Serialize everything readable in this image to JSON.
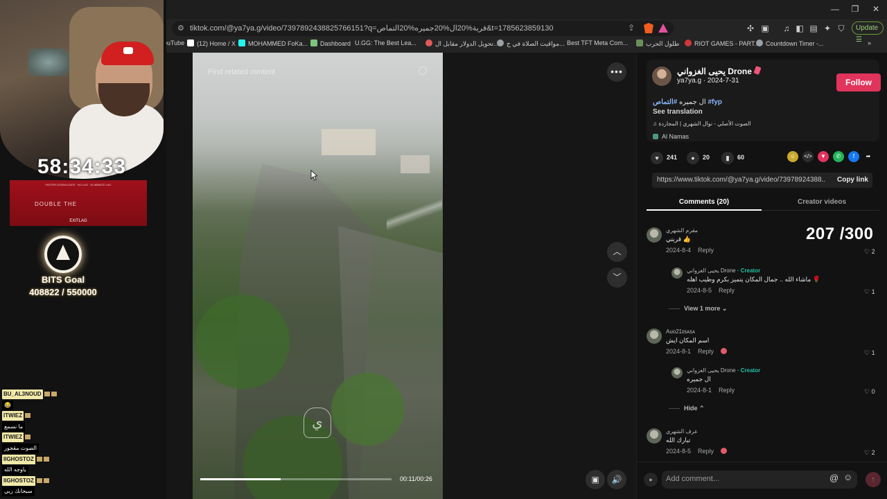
{
  "browser": {
    "url": "tiktok.com/@ya7ya.g/video/7397892438825766151?q=قرية%20ال%20جميره%20التماص&t=1785623859130",
    "update_label": "Update",
    "bookmarks": [
      {
        "label": "ouTube",
        "color": "#e0342f"
      },
      {
        "label": "(12) Home / X",
        "color": "#ffffff"
      },
      {
        "label": "MOHAMMED FoKa...",
        "color": "#25f4ee"
      },
      {
        "label": "Dashboard",
        "color": "#7bc67e"
      },
      {
        "label": "U.GG: The Best Lea...",
        "color": "#3b82f6"
      },
      {
        "label": "تحويل الدولار مقابل ال...",
        "color": "#e05a5a"
      },
      {
        "label": "مواقيت الصلاة في ج...",
        "color": "#9aa0a6"
      },
      {
        "label": "Best TFT Meta Com...",
        "color": "#c9a24a"
      },
      {
        "label": "طلول الحرب",
        "color": "#6b8e5a"
      },
      {
        "label": "RIOT GAMES - PART...",
        "color": "#d13639"
      },
      {
        "label": "Countdown Timer -...",
        "color": "#9aa0a6"
      }
    ]
  },
  "overlay": {
    "timer": "58:34:33",
    "banner_top": "FASTER DOWNLOADS · NO LAG · ELIMINATE LAG",
    "banner_mid": "DOUBLE      THE",
    "banner_bottom": "EXITLAG",
    "goal_title": "BITS Goal",
    "goal_value": "408822 / 550000",
    "chat": [
      {
        "user": "BU_AL3NOUD",
        "msg": ""
      },
      {
        "user": "",
        "msg": "😂"
      },
      {
        "user": "ITWIEZ",
        "msg": ""
      },
      {
        "user": "",
        "msg": "ما نسمع"
      },
      {
        "user": "ITWIEZ",
        "msg": ""
      },
      {
        "user": "",
        "msg": "الصوت مقجور"
      },
      {
        "user": "IIGHOSTOZ",
        "msg": ""
      },
      {
        "user": "",
        "msg": "ياوجه الله"
      },
      {
        "user": "IIGHOSTOZ",
        "msg": ""
      },
      {
        "user": "",
        "msg": "سبحانك ربي"
      }
    ]
  },
  "video": {
    "search_placeholder": "Find related content",
    "watermark": "ي",
    "progress": 0.42,
    "time": "00:11/00:26"
  },
  "post": {
    "author_name": "يحيى الغزواني Drone",
    "handle_date": "ya7ya.g · 2024-7-31",
    "follow_label": "Follow",
    "caption_text": "ال جميره",
    "caption_tag1": "#التماص",
    "caption_tag2": "#fyp",
    "see_translation": "See translation",
    "music": "♫  الصوت الأصلي - نوال الشهري | المجاردة",
    "location": "Al Namas",
    "likes": "241",
    "comments": "20",
    "saves": "60",
    "link": "https://www.tiktok.com/@ya7ya.g/video/73978924388...",
    "copy_label": "Copy link",
    "tab_comments": "Comments (20)",
    "tab_creator": "Creator videos"
  },
  "score": "207 /300",
  "comments_list": [
    {
      "user": "مقرم الشهري",
      "text": "قربتي 👍",
      "date": "2024-8-4",
      "reply": "Reply",
      "likes": "2"
    },
    {
      "user": "يحيى الغزواني Drone",
      "creator": "· Creator",
      "text": "ماشاء الله .. جمال المكان يتميز بكرم وطيب اهله 🌹",
      "date": "2024-8-5",
      "reply": "Reply",
      "likes": "1"
    },
    {
      "user": "Auo21ɪsᴀsᴀ",
      "text": "اسم المكان ايش",
      "date": "2024-8-1",
      "reply": "Reply",
      "likes": "1"
    },
    {
      "user": "يحيى الغزواني Drone",
      "creator": "· Creator",
      "text": "ال جميره",
      "date": "2024-8-1",
      "reply": "Reply",
      "likes": "0"
    },
    {
      "user": "عرف الشهري",
      "text": "تبارك الله",
      "date": "2024-8-5",
      "reply": "Reply",
      "likes": "2"
    }
  ],
  "view_more": "View 1 more",
  "hide": "Hide",
  "add_comment_placeholder": "Add comment..."
}
